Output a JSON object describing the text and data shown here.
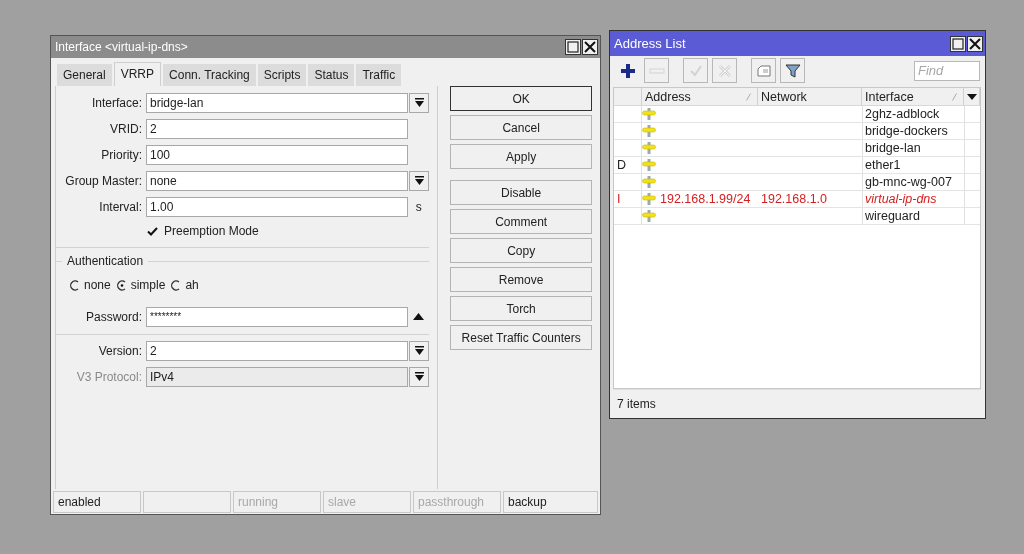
{
  "interface_window": {
    "title": "Interface <virtual-ip-dns>",
    "tabs": [
      {
        "label": "General",
        "selected": false
      },
      {
        "label": "VRRP",
        "selected": true
      },
      {
        "label": "Conn. Tracking",
        "selected": false
      },
      {
        "label": "Scripts",
        "selected": false
      },
      {
        "label": "Status",
        "selected": false
      },
      {
        "label": "Traffic",
        "selected": false
      }
    ],
    "fields": [
      {
        "kind": "select",
        "label": "Interface:",
        "value": "bridge-lan"
      },
      {
        "kind": "text",
        "label": "VRID:",
        "value": "2"
      },
      {
        "kind": "text",
        "label": "Priority:",
        "value": "100"
      },
      {
        "kind": "select",
        "label": "Group Master:",
        "value": "none"
      },
      {
        "kind": "text",
        "label": "Interval:",
        "value": "1.00",
        "unit": "s"
      }
    ],
    "preemption": {
      "label": "Preemption Mode",
      "checked": true
    },
    "authentication": {
      "title": "Authentication",
      "options": [
        {
          "label": "none",
          "selected": false
        },
        {
          "label": "simple",
          "selected": true
        },
        {
          "label": "ah",
          "selected": false
        }
      ],
      "password": {
        "label": "Password:",
        "value": "********"
      }
    },
    "version_fields": [
      {
        "kind": "select",
        "label": "Version:",
        "value": "2",
        "disabled": false
      },
      {
        "kind": "select",
        "label": "V3 Protocol:",
        "value": "IPv4",
        "disabled": true
      }
    ],
    "dialog_buttons": [
      {
        "label": "OK",
        "default": true
      },
      {
        "label": "Cancel",
        "default": false
      },
      {
        "label": "Apply",
        "default": false
      }
    ],
    "action_buttons": [
      {
        "label": "Disable"
      },
      {
        "label": "Comment"
      },
      {
        "label": "Copy"
      },
      {
        "label": "Remove"
      },
      {
        "label": "Torch"
      },
      {
        "label": "Reset Traffic Counters"
      }
    ],
    "status_bar": [
      {
        "kind": "text",
        "label": "enabled",
        "active": true
      },
      {
        "kind": "empty"
      },
      {
        "kind": "text",
        "label": "running",
        "active": false
      },
      {
        "kind": "text",
        "label": "slave",
        "active": false
      },
      {
        "kind": "text",
        "label": "passthrough",
        "active": false
      },
      {
        "kind": "text",
        "label": "backup",
        "active": true
      }
    ]
  },
  "address_list": {
    "title": "Address List",
    "toolbar": [
      {
        "kind": "add",
        "disabled": false
      },
      {
        "kind": "remove",
        "disabled": true
      },
      {
        "kind": "enable",
        "disabled": true
      },
      {
        "kind": "disable",
        "disabled": true
      },
      {
        "kind": "comment",
        "disabled": false
      },
      {
        "kind": "filter",
        "disabled": false
      }
    ],
    "find": {
      "placeholder": "Find"
    },
    "columns": [
      {
        "label": "Address",
        "sorted": true
      },
      {
        "label": "Network",
        "sorted": false
      },
      {
        "label": "Interface",
        "sorted": true
      }
    ],
    "rows": [
      {
        "interface": "2ghz-adblock",
        "invalid": false
      },
      {
        "interface": "bridge-dockers",
        "invalid": false
      },
      {
        "interface": "bridge-lan",
        "invalid": false
      },
      {
        "flag": "D",
        "interface": "ether1",
        "invalid": false
      },
      {
        "interface": "gb-mnc-wg-007",
        "invalid": false
      },
      {
        "flag": "I",
        "address": "192.168.1.99/24",
        "network": "192.168.1.0",
        "interface": "virtual-ip-dns",
        "invalid": true
      },
      {
        "interface": "wireguard",
        "invalid": false
      }
    ],
    "footer": "7 items"
  }
}
